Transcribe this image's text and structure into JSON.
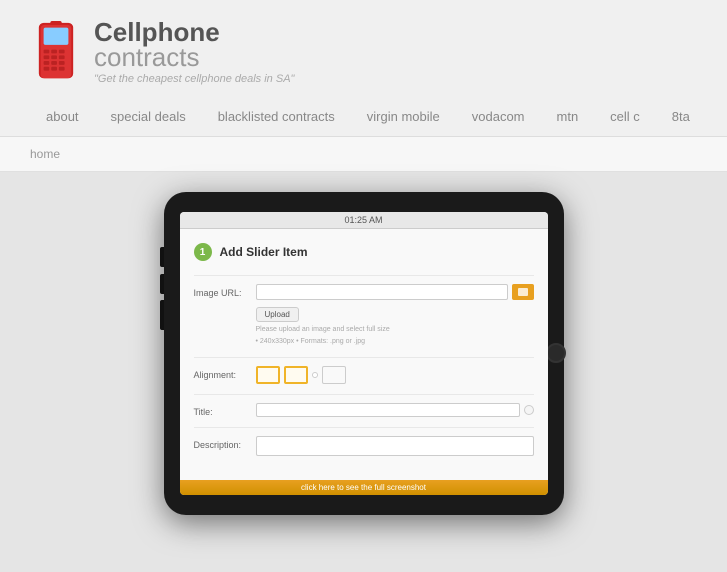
{
  "brand": {
    "name_part1": "Cellphone",
    "name_part2": "contracts",
    "tagline": "\"Get the cheapest cellphone deals in SA\""
  },
  "nav": {
    "items": [
      {
        "label": "about",
        "id": "about"
      },
      {
        "label": "special deals",
        "id": "special-deals"
      },
      {
        "label": "blacklisted contracts",
        "id": "blacklisted-contracts"
      },
      {
        "label": "virgin mobile",
        "id": "virgin-mobile"
      },
      {
        "label": "vodacom",
        "id": "vodacom"
      },
      {
        "label": "mtn",
        "id": "mtn"
      },
      {
        "label": "cell c",
        "id": "cell-c"
      },
      {
        "label": "8ta",
        "id": "8ta"
      }
    ]
  },
  "breadcrumb": {
    "label": "home"
  },
  "tablet": {
    "status_time": "01:25 AM",
    "form": {
      "title": "Add Slider Item",
      "step": "1",
      "fields": {
        "image_url": {
          "label": "Image URL:",
          "placeholder": "",
          "upload_btn": "Upload",
          "hint_line1": "Please upload an image and select full size",
          "hint_line2": "• 240x330px  • Formats: .png or .jpg"
        },
        "alignment": {
          "label": "Alignment:"
        },
        "title": {
          "label": "Title:"
        },
        "description": {
          "label": "Description:"
        }
      }
    },
    "bottom_hint": "click here to see the full screenshot"
  },
  "colors": {
    "accent_orange": "#e8a020",
    "accent_green": "#7cb84a",
    "nav_text": "#888888",
    "brand_gray": "#555555"
  }
}
